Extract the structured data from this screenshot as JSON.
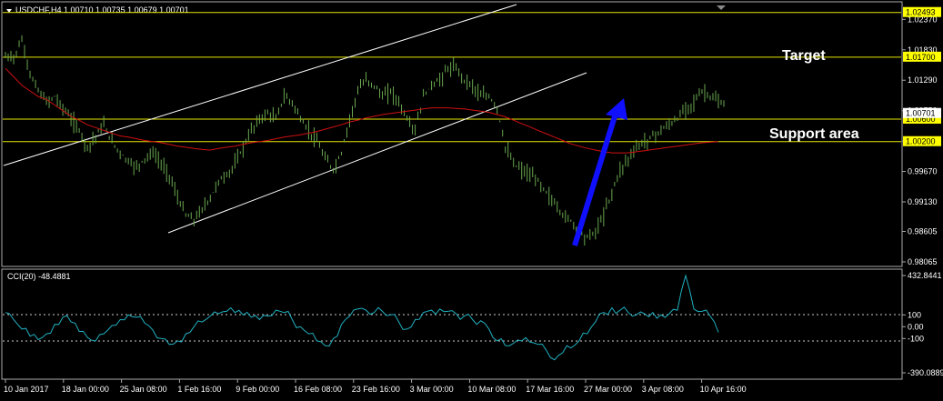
{
  "window": {
    "symbol_header": "USDCHF,H4  1.00710 1.00735 1.00679 1.00701",
    "menu_icon": "triangle-down-icon"
  },
  "colors": {
    "background": "#000000",
    "candles": "#6aa84f",
    "ma": "#d01010",
    "channel": "#ffffff",
    "levels": "#e6e600",
    "cci": "#20b0c0",
    "arrow": "#1010ff"
  },
  "annotations": {
    "target": "Target",
    "support": "Support area"
  },
  "price_axis": {
    "ticks": [
      "1.02370",
      "1.01830",
      "1.01290",
      "1.00750",
      "1.00210",
      "0.99670",
      "0.99130",
      "0.98605",
      "0.98065"
    ],
    "level_labels": [
      "1.02493",
      "1.01700",
      "1.00600",
      "1.00200"
    ],
    "current_label": "1.00701"
  },
  "cci_panel": {
    "title": "CCI(20) -48.4881",
    "ticks": [
      "432.8441",
      "100",
      "0.00",
      "-100",
      "-390.0889"
    ]
  },
  "time_axis": {
    "labels": [
      "10 Jan 2017",
      "18 Jan 00:00",
      "25 Jan 08:00",
      "1 Feb 16:00",
      "9 Feb 00:00",
      "16 Feb 08:00",
      "23 Feb 16:00",
      "3 Mar 00:00",
      "10 Mar 08:00",
      "17 Mar 16:00",
      "27 Mar 00:00",
      "3 Apr 08:00",
      "10 Apr 16:00"
    ]
  },
  "chart_data": {
    "type": "line",
    "title": "USDCHF,H4  1.00710 1.00735 1.00679 1.00701",
    "ylim": [
      0.98,
      1.0265
    ],
    "horizontal_levels": [
      1.02493,
      1.017,
      1.006,
      1.002
    ],
    "series": [
      {
        "name": "",
        "values": [
          1.017,
          1.02,
          1.014,
          1.011,
          1.009,
          1.01,
          1.008,
          1.006,
          1.004,
          1.001,
          1.003,
          1.005,
          1.002,
          1.0,
          0.9985,
          0.9975,
          0.999,
          1.0,
          0.998,
          0.996,
          0.992,
          0.989,
          0.988,
          0.99,
          0.992,
          0.995,
          0.996,
          0.998,
          1.001,
          1.004,
          1.006,
          1.007,
          1.006,
          1.01,
          1.009,
          1.006,
          1.004,
          1.002,
          0.999,
          0.997,
          1.0,
          1.006,
          1.011,
          1.013,
          1.012,
          1.01,
          1.011,
          1.009,
          1.006,
          1.004,
          1.01,
          1.012,
          1.013,
          1.015,
          1.015,
          1.013,
          1.012,
          1.01,
          1.01,
          1.008,
          1.001,
          0.998,
          0.997,
          0.996,
          0.995,
          0.993,
          0.991,
          0.989,
          0.988,
          0.986,
          0.985,
          0.986,
          0.989,
          0.993,
          0.997,
          0.999,
          1.001,
          1.002,
          1.003,
          1.004,
          1.005,
          1.006,
          1.008,
          1.009,
          1.011,
          1.01,
          1.009,
          1.008
        ]
      },
      {
        "name": "",
        "values": [
          1.015,
          1.0135,
          1.012,
          1.011,
          1.01,
          1.0095,
          1.0085,
          1.0075,
          1.0065,
          1.0058,
          1.005,
          1.0045,
          1.004,
          1.0035,
          1.003,
          1.0028,
          1.0025,
          1.0022,
          1.002,
          1.0018,
          1.0015,
          1.0012,
          1.001,
          1.0008,
          1.0006,
          1.0005,
          1.0008,
          1.001,
          1.0012,
          1.0015,
          1.0018,
          1.002,
          1.0022,
          1.0025,
          1.0028,
          1.003,
          1.0032,
          1.0035,
          1.0038,
          1.0042,
          1.0046,
          1.005,
          1.0055,
          1.0058,
          1.0062,
          1.0065,
          1.0068,
          1.007,
          1.0072,
          1.0074,
          1.0076,
          1.0078,
          1.008,
          1.008,
          1.008,
          1.0079,
          1.0078,
          1.0076,
          1.0074,
          1.0072,
          1.0068,
          1.0064,
          1.0058,
          1.0052,
          1.0046,
          1.004,
          1.0034,
          1.0028,
          1.0022,
          1.0016,
          1.0012,
          1.0008,
          1.0005,
          1.0002,
          1.0,
          1.0,
          1.0,
          1.0002,
          1.0004,
          1.0006,
          1.0008,
          1.001,
          1.0012,
          1.0014,
          1.0016,
          1.0018,
          1.0019,
          1.002
        ]
      }
    ],
    "cci": {
      "name": "CCI(20)",
      "ylim": [
        -390.0889,
        432.8441
      ],
      "values": [
        120,
        60,
        -20,
        -80,
        -110,
        -60,
        20,
        80,
        40,
        -40,
        -90,
        -120,
        -60,
        10,
        60,
        100,
        80,
        30,
        -30,
        -100,
        -150,
        -120,
        -60,
        0,
        40,
        90,
        110,
        130,
        120,
        100,
        80,
        60,
        90,
        140,
        120,
        60,
        0,
        -60,
        -120,
        -160,
        -100,
        20,
        90,
        150,
        140,
        120,
        130,
        100,
        40,
        -20,
        60,
        120,
        140,
        150,
        130,
        110,
        90,
        60,
        50,
        -20,
        -120,
        -160,
        -140,
        -120,
        -130,
        -150,
        -200,
        -280,
        -220,
        -180,
        -120,
        -60,
        40,
        120,
        160,
        140,
        120,
        100,
        110,
        120,
        100,
        110,
        140,
        432,
        150,
        130,
        90,
        -48
      ]
    }
  }
}
